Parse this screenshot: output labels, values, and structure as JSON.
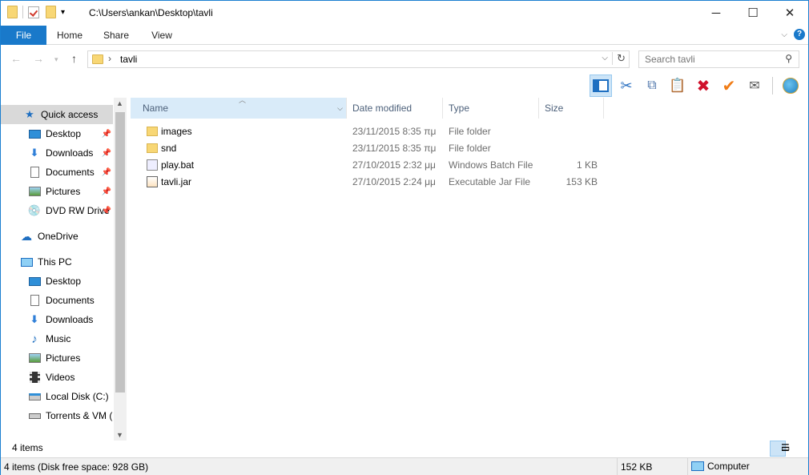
{
  "title_bar": {
    "path": "C:\\Users\\ankan\\Desktop\\tavli",
    "minimize": "─",
    "maximize": "☐",
    "close": "✕"
  },
  "ribbon": {
    "tabs": [
      "File",
      "Home",
      "Share",
      "View"
    ],
    "help": "?"
  },
  "address": {
    "crumb": "tavli",
    "search_placeholder": "Search tavli"
  },
  "nav_pane": {
    "items": [
      {
        "label": "Quick access",
        "icon": "star-icon"
      },
      {
        "label": "Desktop",
        "icon": "desktop-icon"
      },
      {
        "label": "Downloads",
        "icon": "download-icon"
      },
      {
        "label": "Documents",
        "icon": "documents-icon"
      },
      {
        "label": "Pictures",
        "icon": "pictures-icon"
      },
      {
        "label": "DVD RW Drive",
        "icon": "dvd-drive-icon"
      },
      {
        "label": "OneDrive",
        "icon": "cloud-icon"
      },
      {
        "label": "This PC",
        "icon": "computer-icon"
      },
      {
        "label": "Desktop",
        "icon": "desktop-icon"
      },
      {
        "label": "Documents",
        "icon": "documents-icon"
      },
      {
        "label": "Downloads",
        "icon": "download-icon"
      },
      {
        "label": "Music",
        "icon": "music-icon"
      },
      {
        "label": "Pictures",
        "icon": "pictures-icon"
      },
      {
        "label": "Videos",
        "icon": "videos-icon"
      },
      {
        "label": "Local Disk (C:)",
        "icon": "disk-icon"
      },
      {
        "label": "Torrents & VM (I",
        "icon": "drive-icon"
      }
    ]
  },
  "columns": [
    "Name",
    "Date modified",
    "Type",
    "Size"
  ],
  "files": [
    {
      "name": "images",
      "date": "23/11/2015 8:35 πμ",
      "type": "File folder",
      "size": "",
      "icon": "folder-icon"
    },
    {
      "name": "snd",
      "date": "23/11/2015 8:35 πμ",
      "type": "File folder",
      "size": "",
      "icon": "folder-icon"
    },
    {
      "name": "play.bat",
      "date": "27/10/2015 2:32 μμ",
      "type": "Windows Batch File",
      "size": "1 KB",
      "icon": "batch-file-icon"
    },
    {
      "name": "tavli.jar",
      "date": "27/10/2015 2:24 μμ",
      "type": "Executable Jar File",
      "size": "153 KB",
      "icon": "jar-file-icon"
    }
  ],
  "footer": {
    "item_count": "4 items"
  },
  "status": {
    "main": "4 items (Disk free space: 928 GB)",
    "size": "152 KB",
    "location": "Computer"
  },
  "colors": {
    "accent": "#1979ca",
    "selection": "#cce4f7"
  }
}
